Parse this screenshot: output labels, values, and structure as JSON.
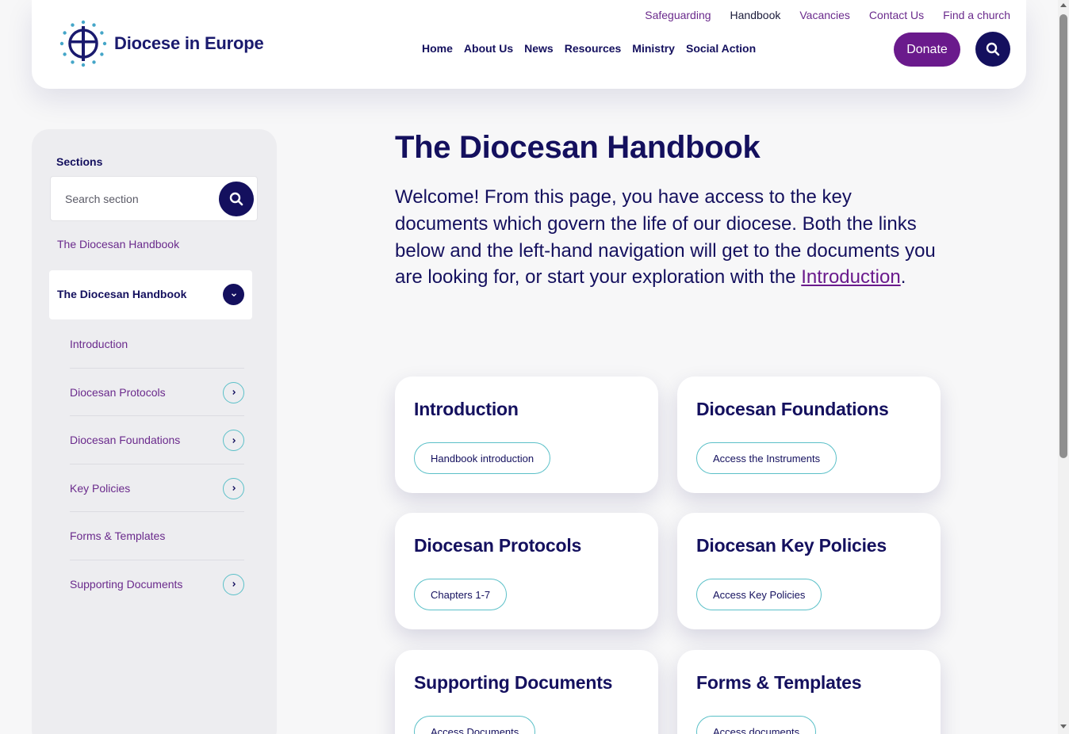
{
  "header": {
    "logo_text": "Diocese in Europe",
    "top_links": [
      "Safeguarding",
      "Handbook",
      "Vacancies",
      "Contact Us",
      "Find a church"
    ],
    "active_top_link": "Handbook",
    "main_nav": [
      "Home",
      "About Us",
      "News",
      "Resources",
      "Ministry",
      "Social Action"
    ],
    "donate_label": "Donate",
    "search_icon": "search-icon"
  },
  "sidebar": {
    "title": "Sections",
    "search_placeholder": "Search section",
    "top_link": "The Diocesan Handbook",
    "active_item": "The Diocesan Handbook",
    "items": [
      {
        "label": "Introduction",
        "has_children": false
      },
      {
        "label": "Diocesan Protocols",
        "has_children": true
      },
      {
        "label": "Diocesan Foundations",
        "has_children": true
      },
      {
        "label": "Key Policies",
        "has_children": true
      },
      {
        "label": "Forms & Templates",
        "has_children": false
      },
      {
        "label": "Supporting Documents",
        "has_children": true
      }
    ]
  },
  "main": {
    "title": "The Diocesan Handbook",
    "intro_text": "Welcome! From this page, you have access to the key documents which govern the life of our diocese. Both the links below and the left-hand navigation will get to the documents you are looking for, or start your exploration with the ",
    "intro_link": "Introduction",
    "intro_end": ".",
    "cards": [
      {
        "title": "Introduction",
        "button": "Handbook introduction"
      },
      {
        "title": "Diocesan Foundations",
        "button": "Access the Instruments"
      },
      {
        "title": "Diocesan Protocols",
        "button": "Chapters 1-7"
      },
      {
        "title": "Diocesan Key Policies",
        "button": "Access Key Policies"
      },
      {
        "title": "Supporting Documents",
        "button": "Access Documents"
      },
      {
        "title": "Forms & Templates",
        "button": "Access documents"
      }
    ]
  },
  "colors": {
    "navy": "#14105e",
    "purple": "#6a1a8c",
    "teal": "#5bc0c8"
  }
}
